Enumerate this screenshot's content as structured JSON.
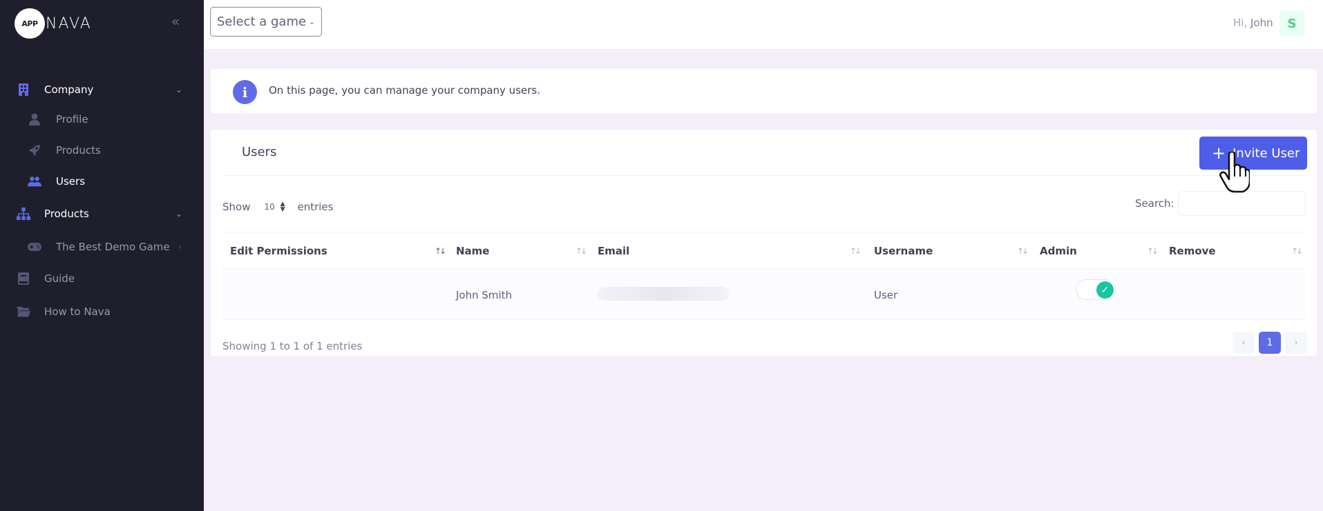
{
  "brand": {
    "mark": "APP",
    "name": "NAVA"
  },
  "sidebar": {
    "items": [
      {
        "label": "Company",
        "icon": "building-icon",
        "expanded": true,
        "children": [
          {
            "label": "Profile",
            "icon": "user-icon"
          },
          {
            "label": "Products",
            "icon": "rocket-icon"
          },
          {
            "label": "Users",
            "icon": "users-icon",
            "active": true
          }
        ]
      },
      {
        "label": "Products",
        "icon": "sitemap-icon",
        "expanded": true,
        "children": [
          {
            "label": "The Best Demo Game",
            "icon": "gamepad-icon"
          }
        ]
      },
      {
        "label": "Guide",
        "icon": "book-icon"
      },
      {
        "label": "How to Nava",
        "icon": "folder-icon"
      }
    ]
  },
  "header": {
    "game_select": "Select a game",
    "greeting_prefix": "Hi,",
    "greeting_name": "John",
    "avatar_initial": "S"
  },
  "info": {
    "text": "On this page, you can manage your company users."
  },
  "users_card": {
    "title": "Users",
    "invite_label": "Invite User",
    "show_label": "Show",
    "page_length": "10",
    "entries_label": "entries",
    "search_label": "Search:",
    "columns": [
      "Edit Permissions",
      "Name",
      "Email",
      "Username",
      "Admin",
      "Remove"
    ],
    "rows": [
      {
        "edit_permissions": "",
        "name": "John Smith",
        "email": "",
        "username": "User",
        "admin": true,
        "remove": ""
      }
    ],
    "showing_text": "Showing 1 to 1 of 1 entries",
    "pagination": {
      "prev": "‹",
      "current": "1",
      "next": "›"
    }
  },
  "colors": {
    "sidebar_bg": "#1e1e2d",
    "primary": "#4f5ee8",
    "toggle_on": "#1bc5a0",
    "page_bg": "#f3eefa"
  }
}
